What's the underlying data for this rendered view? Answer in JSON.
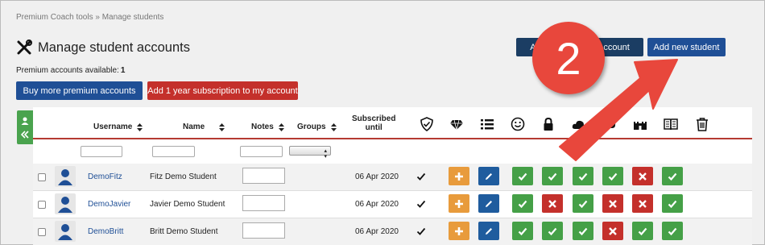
{
  "breadcrumb": "Premium Coach tools » Manage students",
  "page_title": "Manage student accounts",
  "premium": {
    "label": "Premium accounts available:",
    "count": "1"
  },
  "buttons": {
    "buy_more": "Buy more premium accounts",
    "add_year": "Add 1 year subscription to my account",
    "add_student_account": "Add new student account",
    "add_new_student": "Add new student"
  },
  "callout_number": "2",
  "table": {
    "headers": {
      "username": "Username",
      "name": "Name",
      "notes": "Notes",
      "groups": "Groups",
      "subscribed_1": "Subscribed",
      "subscribed_2": "until"
    },
    "header_icons": [
      "shield-check-icon",
      "diamond-icon",
      "list-icon",
      "smiley-icon",
      "lock-icon",
      "cloud-icon",
      "castle-icon",
      "book-icon",
      "trash-icon"
    ],
    "rows": [
      {
        "username": "DemoFitz",
        "name": "Fitz Demo Student",
        "subscribed": "06 Apr 2020",
        "states": [
          "check",
          "check",
          "check",
          "check",
          "cross",
          "check"
        ]
      },
      {
        "username": "DemoJavier",
        "name": "Javier Demo Student",
        "subscribed": "06 Apr 2020",
        "states": [
          "check",
          "cross",
          "check",
          "cross",
          "cross",
          "check"
        ]
      },
      {
        "username": "DemoBritt",
        "name": "Britt Demo Student",
        "subscribed": "06 Apr 2020",
        "states": [
          "check",
          "check",
          "check",
          "cross",
          "check",
          "check"
        ]
      }
    ]
  },
  "colors": {
    "blue_button": "#1f4f96",
    "navy_button": "#1b3d63",
    "red_button": "#c4302b",
    "green_state": "#45a047",
    "red_state": "#c4302b",
    "orange_add": "#e89b3c",
    "callout": "#e8473c",
    "header_rule": "#b53a32"
  }
}
